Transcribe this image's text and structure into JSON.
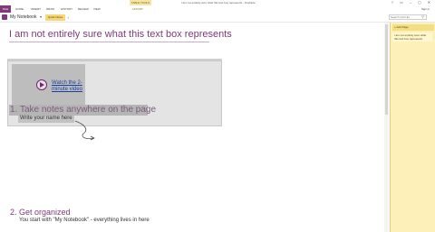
{
  "window": {
    "title": "I am not entirely sure what this text box represents - OneNote",
    "contextual_tab": "TABLE TOOLS",
    "controls": "? ▭ – ◻ ✕"
  },
  "ribbon": {
    "file": "FILE",
    "tabs": [
      "HOME",
      "INSERT",
      "DRAW",
      "HISTORY",
      "REVIEW",
      "VIEW",
      "LAYOUT"
    ],
    "signin": "Sign in"
  },
  "notebook": {
    "name": "My Notebook",
    "caret": "▾",
    "section": "Quick Notes",
    "add_section": "+"
  },
  "search": {
    "placeholder": "Search (Ctrl+E)"
  },
  "pages_panel": {
    "add_page": "+ Add Page",
    "items": [
      "I am not entirely sure what this text box represents"
    ]
  },
  "page": {
    "title": "I am not entirely sure what this text box represents",
    "video_link": "Watch the 2-minute video",
    "step1": "1. Take notes anywhere on the page",
    "write_name": "Write your name here",
    "step2": "2. Get organized",
    "step2_desc": "You start with \"My Notebook\" - everything lives in here"
  },
  "colors": {
    "accent": "#80397b",
    "section_tab": "#f7d77a",
    "pages_panel_bg": "#fdf0b8"
  }
}
